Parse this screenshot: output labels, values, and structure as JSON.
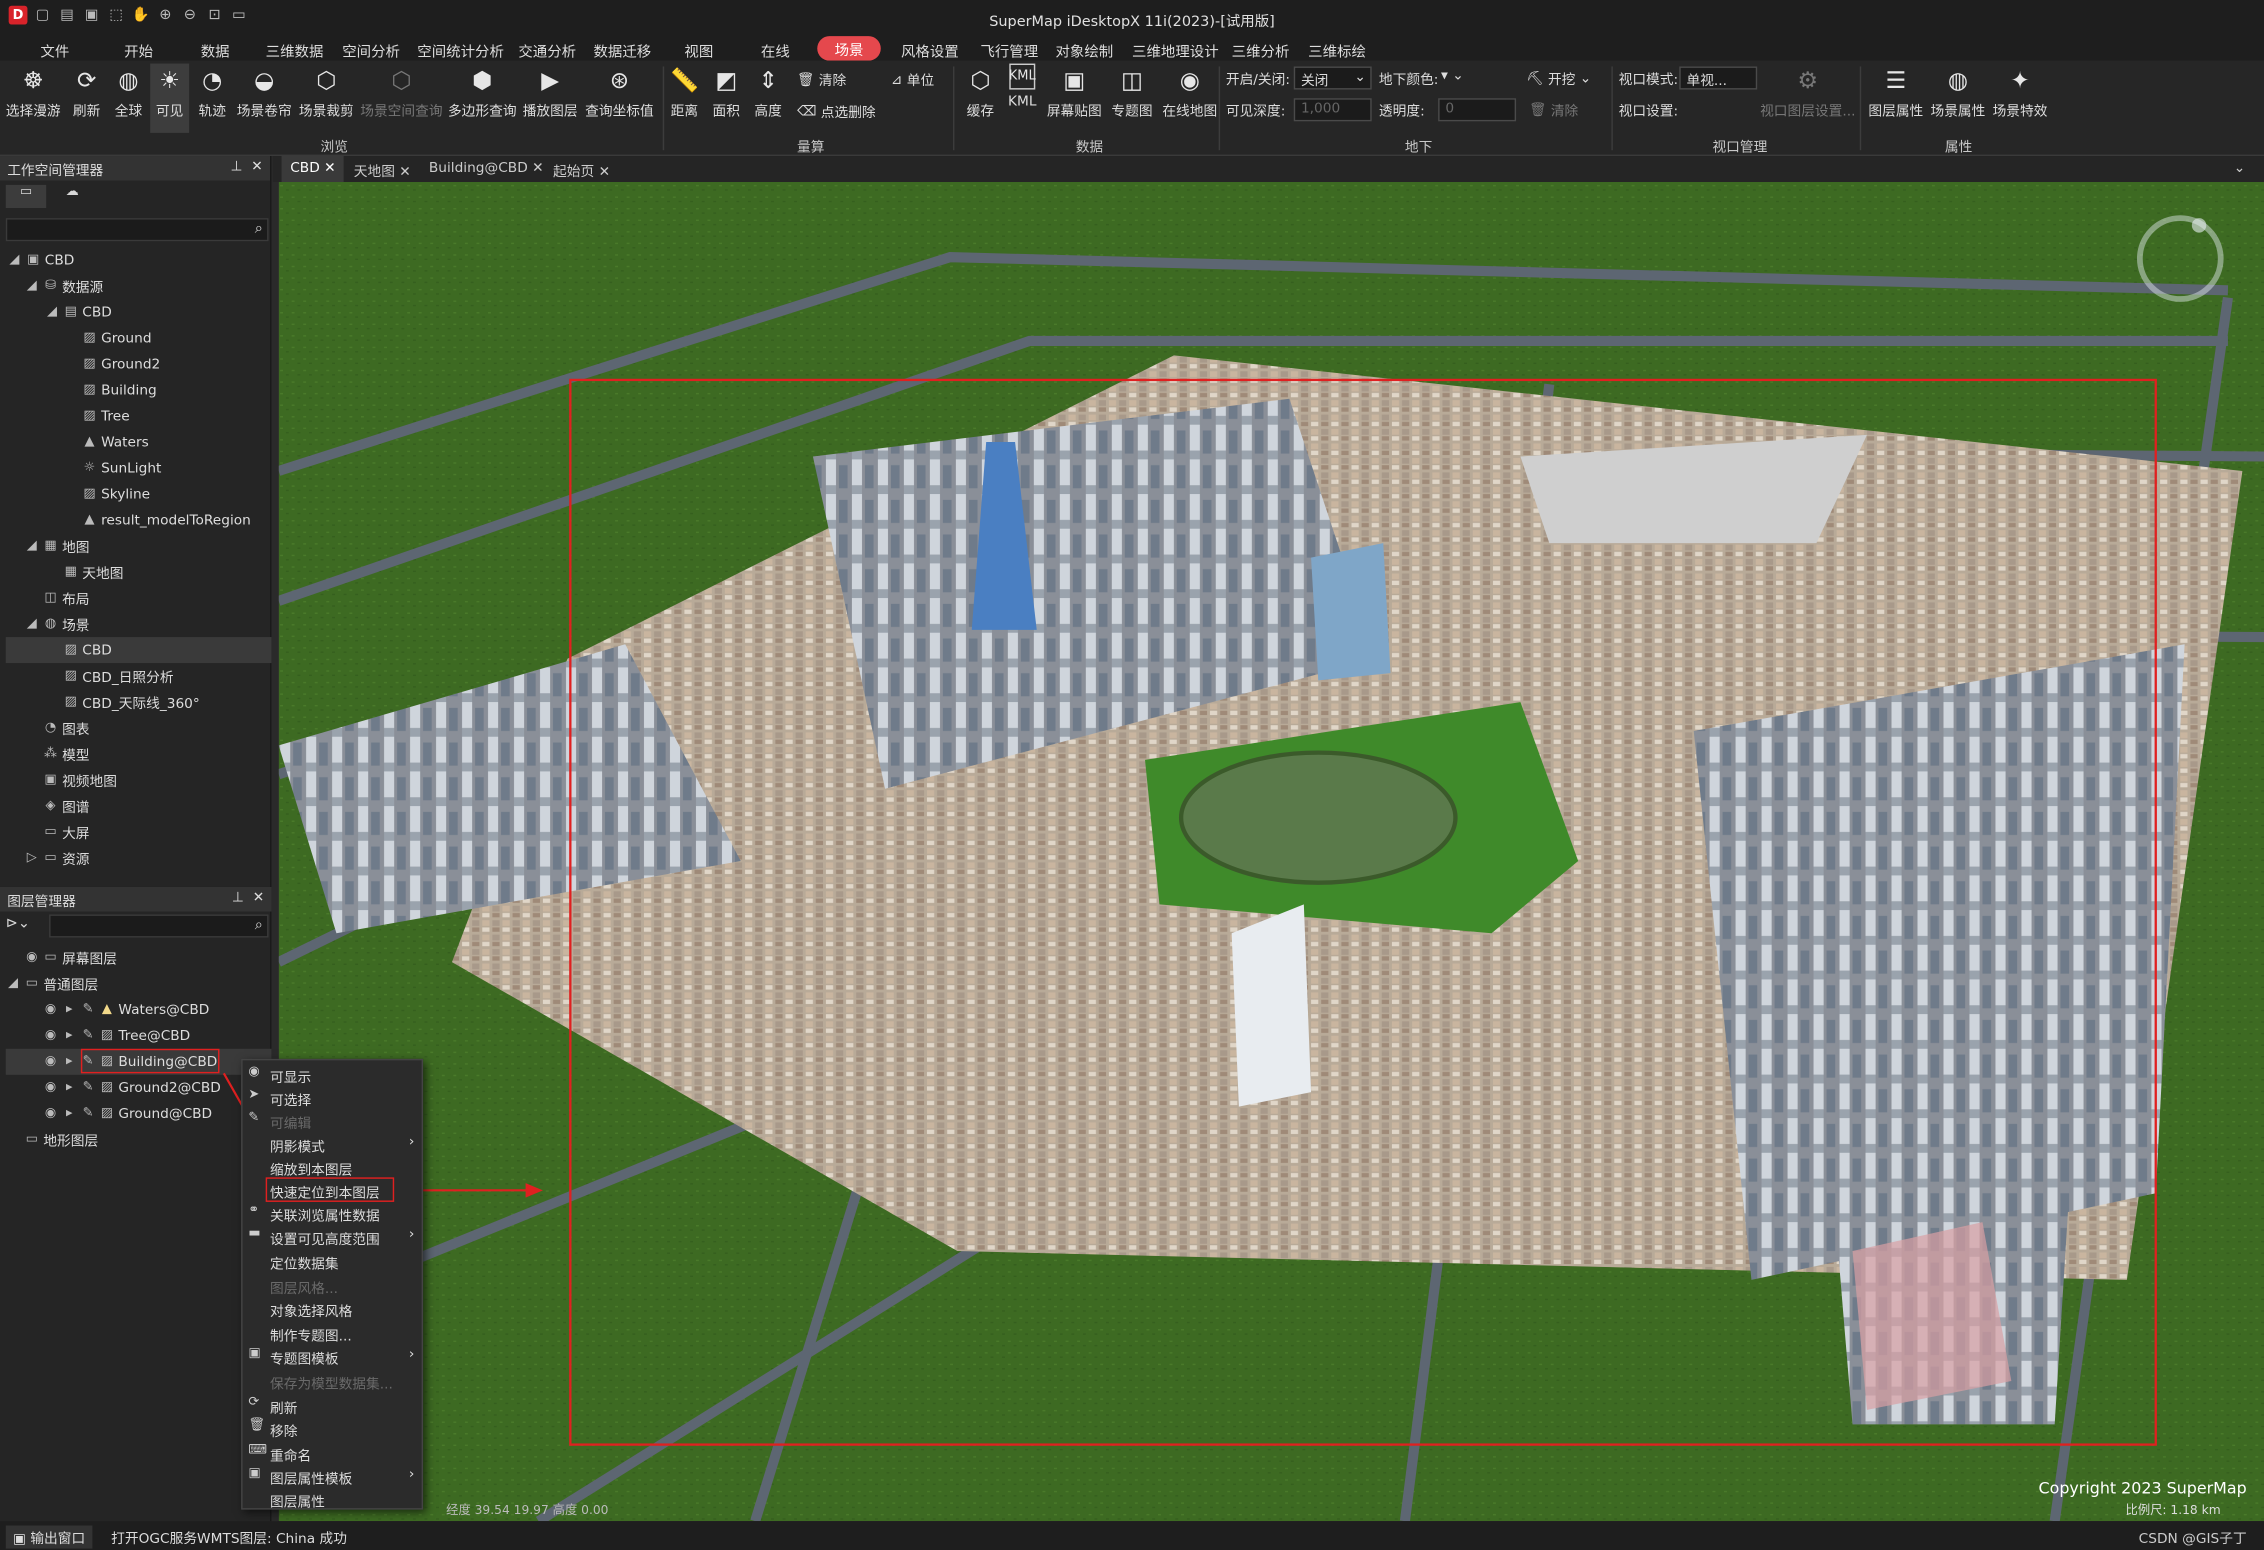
{
  "app": {
    "title": "SuperMap iDesktopX 11i(2023)-[试用版]"
  },
  "menus": [
    "文件",
    "开始",
    "数据",
    "三维数据",
    "空间分析",
    "空间统计分析",
    "交通分析",
    "数据迁移",
    "视图",
    "在线",
    "场景",
    "风格设置",
    "飞行管理",
    "对象绘制",
    "三维地理设计",
    "三维分析",
    "三维标绘"
  ],
  "ribbon": {
    "browse": {
      "buttons": [
        "选择漫游",
        "刷新",
        "全球",
        "可见",
        "轨迹",
        "场景卷帘",
        "场景裁剪",
        "场景空间查询",
        "多边形查询",
        "播放图层",
        "查询坐标值"
      ],
      "group": "浏览"
    },
    "measure": {
      "buttons": [
        "距离",
        "面积",
        "高度"
      ],
      "clear": "清除",
      "unit": "单位",
      "pick_delete": "点选删除",
      "group": "量算"
    },
    "data": {
      "buttons": [
        "缓存",
        "KML",
        "屏幕贴图",
        "专题图",
        "在线地图"
      ],
      "group": "数据"
    },
    "underground": {
      "open_close_label": "开启/关闭:",
      "open_close_value": "关闭",
      "color_label": "地下颜色:",
      "excavate": "开挖",
      "depth_label": "可见深度:",
      "depth_value": "1,000",
      "transparency_label": "透明度:",
      "transparency_value": "0",
      "clear": "清除",
      "group": "地下"
    },
    "viewport": {
      "mode_label": "视口模式:",
      "mode_value": "单视...",
      "settings_label": "视口设置:",
      "layer_settings": "视口图层设置...",
      "group": "视口管理"
    },
    "attributes": {
      "buttons": [
        "图层属性",
        "场景属性",
        "场景特效"
      ],
      "group": "属性"
    }
  },
  "workspace": {
    "title": "工作空间管理器",
    "nodes": [
      {
        "label": "CBD",
        "icon": "workspace-icon"
      },
      {
        "label": "数据源",
        "icon": "datasources-icon"
      },
      {
        "label": "CBD",
        "icon": "datasource-icon"
      },
      {
        "label": "Ground",
        "icon": "model-dataset-icon"
      },
      {
        "label": "Ground2",
        "icon": "model-dataset-icon"
      },
      {
        "label": "Building",
        "icon": "model-dataset-icon"
      },
      {
        "label": "Tree",
        "icon": "model-dataset-icon"
      },
      {
        "label": "Waters",
        "icon": "region-dataset-icon"
      },
      {
        "label": "SunLight",
        "icon": "light-dataset-icon"
      },
      {
        "label": "Skyline",
        "icon": "model-dataset-icon"
      },
      {
        "label": "result_modelToRegion",
        "icon": "region-dataset-icon"
      },
      {
        "label": "地图",
        "icon": "maps-icon"
      },
      {
        "label": "天地图",
        "icon": "map-icon"
      },
      {
        "label": "布局",
        "icon": "layout-icon"
      },
      {
        "label": "场景",
        "icon": "scenes-icon"
      },
      {
        "label": "CBD",
        "icon": "scene-icon"
      },
      {
        "label": "CBD_日照分析",
        "icon": "scene-icon"
      },
      {
        "label": "CBD_天际线_360°",
        "icon": "scene-icon"
      },
      {
        "label": "图表",
        "icon": "chart-icon"
      },
      {
        "label": "模型",
        "icon": "model-icon"
      },
      {
        "label": "视频地图",
        "icon": "video-map-icon"
      },
      {
        "label": "图谱",
        "icon": "graph-icon"
      },
      {
        "label": "大屏",
        "icon": "screen-icon"
      },
      {
        "label": "资源",
        "icon": "resources-icon"
      }
    ]
  },
  "layer_manager": {
    "title": "图层管理器",
    "nodes": [
      {
        "label": "屏幕图层"
      },
      {
        "label": "普通图层"
      },
      {
        "label": "Waters@CBD"
      },
      {
        "label": "Tree@CBD"
      },
      {
        "label": "Building@CBD"
      },
      {
        "label": "Ground2@CBD"
      },
      {
        "label": "Ground@CBD"
      },
      {
        "label": "地形图层"
      }
    ]
  },
  "tabs": [
    "CBD",
    "天地图",
    "Building@CBD",
    "起始页"
  ],
  "context_menu": [
    {
      "label": "可显示",
      "enabled": true
    },
    {
      "label": "可选择",
      "enabled": true
    },
    {
      "label": "可编辑",
      "enabled": false
    },
    {
      "label": "阴影模式",
      "enabled": true,
      "submenu": true
    },
    {
      "label": "缩放到本图层",
      "enabled": true
    },
    {
      "label": "快速定位到本图层",
      "enabled": true
    },
    {
      "label": "关联浏览属性数据",
      "enabled": true
    },
    {
      "label": "设置可见高度范围",
      "enabled": true,
      "submenu": true
    },
    {
      "label": "定位数据集",
      "enabled": true
    },
    {
      "label": "图层风格...",
      "enabled": false
    },
    {
      "label": "对象选择风格",
      "enabled": true
    },
    {
      "label": "制作专题图...",
      "enabled": true
    },
    {
      "label": "专题图模板",
      "enabled": true,
      "submenu": true
    },
    {
      "label": "保存为模型数据集...",
      "enabled": false
    },
    {
      "label": "刷新",
      "enabled": true
    },
    {
      "label": "移除",
      "enabled": true
    },
    {
      "label": "重命名",
      "enabled": true
    },
    {
      "label": "图层属性模板",
      "enabled": true,
      "submenu": true
    },
    {
      "label": "图层属性",
      "enabled": true
    }
  ],
  "scene": {
    "copyright": "Copyright 2023 SuperMap",
    "scale_text": "比例尺: 1.18 km",
    "coords_text": "经度 39.54   19.97   高度 0.00"
  },
  "status": {
    "output_window": "输出窗口",
    "message": "打开OGC服务WMTS图层: China 成功",
    "watermark": "CSDN @GIS子丁"
  },
  "colors": {
    "accent": "#e5484d",
    "highlight_box": "#e02020",
    "grass": "#3c6b22",
    "road": "#5d6672"
  }
}
